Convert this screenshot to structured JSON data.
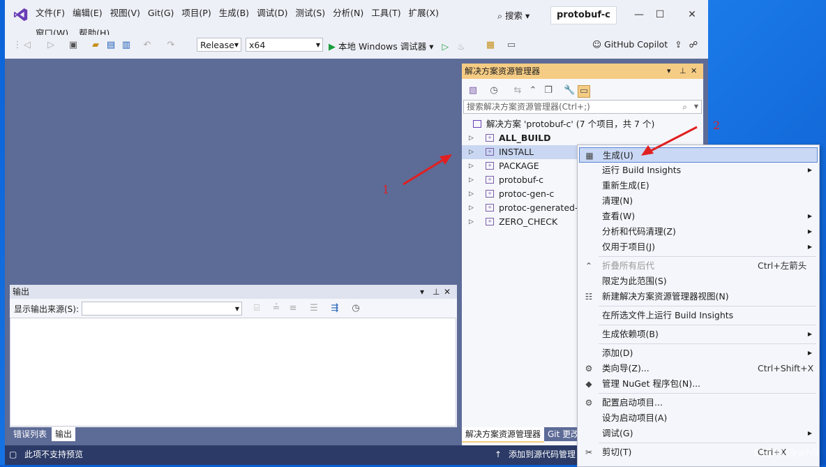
{
  "menu": {
    "row1": [
      "文件(F)",
      "编辑(E)",
      "视图(V)",
      "Git(G)",
      "项目(P)",
      "生成(B)",
      "调试(D)",
      "测试(S)",
      "分析(N)",
      "工具(T)",
      "扩展(X)"
    ],
    "row2": [
      "窗口(W)",
      "帮助(H)"
    ],
    "search": "搜索",
    "title": "protobuf-c"
  },
  "toolbar": {
    "config": "Release",
    "platform": "x64",
    "debugger": "本地 Windows 调试器",
    "copilot": "GitHub Copilot"
  },
  "solution_explorer": {
    "title": "解决方案资源管理器",
    "search_placeholder": "搜索解决方案资源管理器(Ctrl+;)",
    "solution_label": "解决方案 'protobuf-c' (7 个项目，共 7 个)",
    "items": [
      "ALL_BUILD",
      "INSTALL",
      "PACKAGE",
      "protobuf-c",
      "protoc-gen-c",
      "protoc-generated-f",
      "ZERO_CHECK"
    ],
    "tab_active": "解决方案资源管理器",
    "tab_other": "Git 更改"
  },
  "output": {
    "title": "输出",
    "source_label": "显示输出来源(S):",
    "tabs": [
      "错误列表",
      "输出"
    ]
  },
  "status": {
    "left": "此项不支持预览",
    "right": "添加到源代码管理"
  },
  "context_menu": [
    {
      "label": "生成(U)",
      "shortcut": "",
      "sub": false,
      "icon": "build-icon"
    },
    {
      "label": "运行 Build Insights",
      "shortcut": "",
      "sub": true,
      "icon": ""
    },
    {
      "label": "重新生成(E)",
      "shortcut": "",
      "sub": false,
      "icon": ""
    },
    {
      "label": "清理(N)",
      "shortcut": "",
      "sub": false,
      "icon": ""
    },
    {
      "label": "查看(W)",
      "shortcut": "",
      "sub": true,
      "icon": ""
    },
    {
      "label": "分析和代码清理(Z)",
      "shortcut": "",
      "sub": true,
      "icon": ""
    },
    {
      "label": "仅用于项目(J)",
      "shortcut": "",
      "sub": true,
      "icon": ""
    },
    {
      "label": "折叠所有后代",
      "shortcut": "Ctrl+左箭头",
      "sub": false,
      "icon": "collapse-icon"
    },
    {
      "label": "限定为此范围(S)",
      "shortcut": "",
      "sub": false,
      "icon": ""
    },
    {
      "label": "新建解决方案资源管理器视图(N)",
      "shortcut": "",
      "sub": false,
      "icon": "new-view-icon"
    },
    {
      "label": "在所选文件上运行 Build Insights",
      "shortcut": "",
      "sub": false,
      "icon": ""
    },
    {
      "label": "生成依赖项(B)",
      "shortcut": "",
      "sub": true,
      "icon": ""
    },
    {
      "label": "添加(D)",
      "shortcut": "",
      "sub": true,
      "icon": ""
    },
    {
      "label": "类向导(Z)...",
      "shortcut": "Ctrl+Shift+X",
      "sub": false,
      "icon": "class-wizard-icon"
    },
    {
      "label": "管理 NuGet 程序包(N)...",
      "shortcut": "",
      "sub": false,
      "icon": "nuget-icon"
    },
    {
      "label": "配置启动项目...",
      "shortcut": "",
      "sub": false,
      "icon": "gear-icon"
    },
    {
      "label": "设为启动项目(A)",
      "shortcut": "",
      "sub": false,
      "icon": ""
    },
    {
      "label": "调试(G)",
      "shortcut": "",
      "sub": true,
      "icon": ""
    },
    {
      "label": "剪切(T)",
      "shortcut": "Ctrl+X",
      "sub": false,
      "icon": "cut-icon"
    }
  ],
  "annotations": {
    "n1": "1",
    "n2": "2",
    "watermark": "CSDN @wh9"
  }
}
